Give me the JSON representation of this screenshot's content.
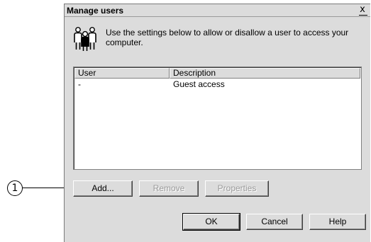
{
  "callout": {
    "number": "1"
  },
  "dialog": {
    "title": "Manage users",
    "close_glyph": "x",
    "instruction": "Use the settings below to allow or disallow a user to access your computer.",
    "icon": "users-icon"
  },
  "listview": {
    "columns": [
      "User",
      "Description"
    ],
    "rows": [
      {
        "user": "-",
        "description": "Guest access"
      }
    ]
  },
  "buttons": {
    "add": "Add...",
    "remove": "Remove",
    "properties": "Properties",
    "ok": "OK",
    "cancel": "Cancel",
    "help": "Help"
  },
  "colors": {
    "dialog_bg": "#dcdcdc",
    "list_bg": "#ffffff",
    "disabled_text": "#9a9a9a"
  }
}
